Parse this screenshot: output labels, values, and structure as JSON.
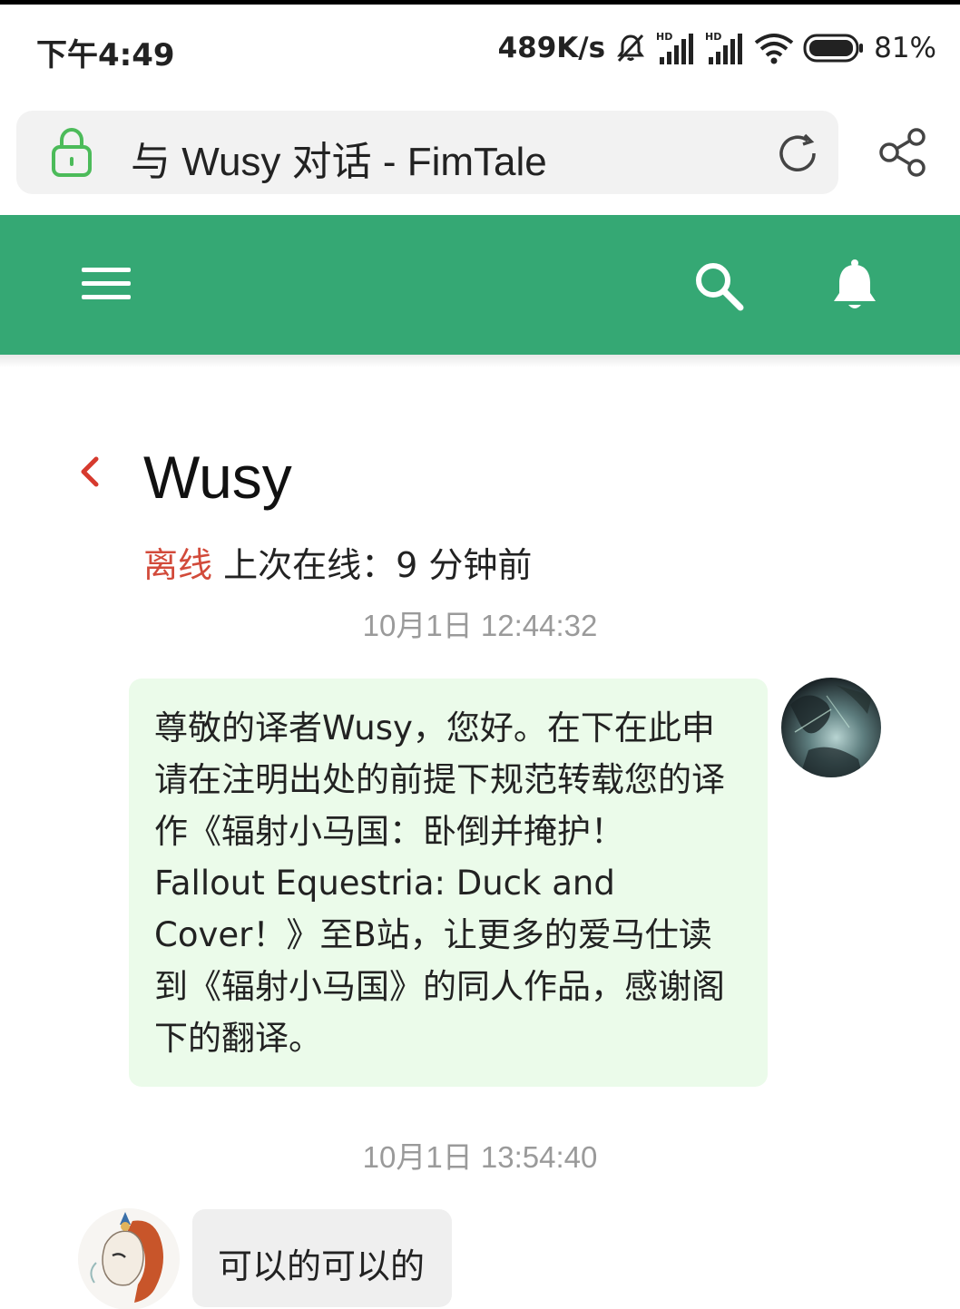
{
  "status_bar": {
    "time": "下午4:49",
    "net_speed": "489K/s",
    "battery_pct": "81%",
    "icons": [
      "mute-icon",
      "hd-signal-icon",
      "hd-signal-icon",
      "wifi-icon",
      "battery-icon"
    ]
  },
  "browser": {
    "page_title": "与 Wusy 对话 - FimTale",
    "icons": [
      "lock-icon",
      "reload-icon",
      "share-icon"
    ]
  },
  "nav": {
    "icons": [
      "menu-icon",
      "search-icon",
      "bell-icon"
    ],
    "color": "#35a874"
  },
  "conversation": {
    "contact_name": "Wusy",
    "status_word": "离线",
    "last_seen": "上次在线：9 分钟前",
    "status_color": "#d24a3a"
  },
  "messages": [
    {
      "timestamp": "10月1日 12:44:32",
      "direction": "outgoing",
      "text": "尊敬的译者Wusy，您好。在下在此申请在注明出处的前提下规范转载您的译作《辐射小马国：卧倒并掩护！ Fallout Equestria: Duck and Cover！》至B站，让更多的爱马仕读到《辐射小马国》的同人作品，感谢阁下的翻译。"
    },
    {
      "timestamp": "10月1日 13:54:40",
      "direction": "incoming",
      "text": "可以的可以的"
    }
  ],
  "colors": {
    "bubble_out": "#ebfbea",
    "bubble_in": "#efefef",
    "timestamp": "#9a9a9a"
  }
}
